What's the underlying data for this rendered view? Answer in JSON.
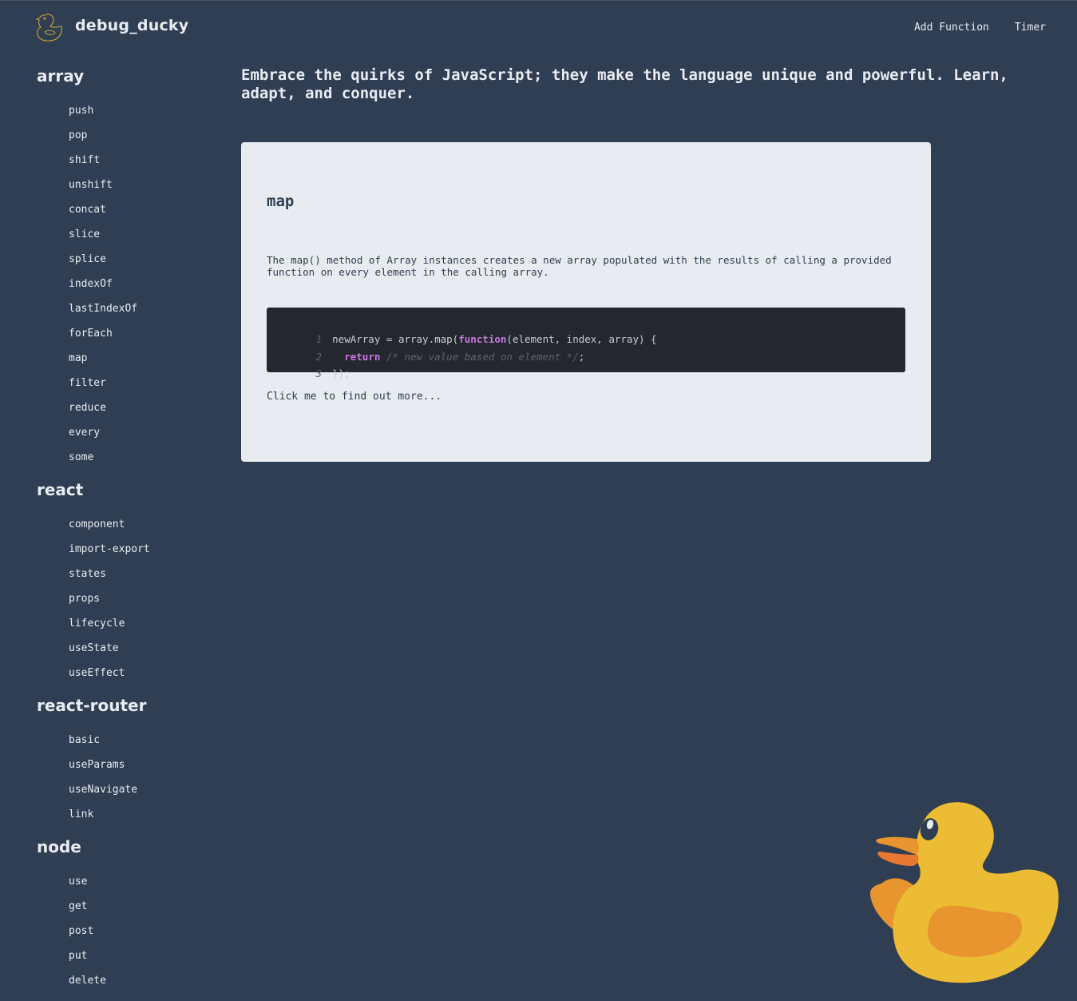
{
  "header": {
    "brand": "debug_ducky",
    "logo_icon": "duck-outline-icon",
    "nav": [
      {
        "label": "Add Function"
      },
      {
        "label": "Timer"
      }
    ]
  },
  "tagline": "Embrace the quirks of JavaScript; they make the language unique and powerful. Learn, adapt, and conquer.",
  "sidebar": {
    "groups": [
      {
        "title": "array",
        "items": [
          "push",
          "pop",
          "shift",
          "unshift",
          "concat",
          "slice",
          "splice",
          "indexOf",
          "lastIndexOf",
          "forEach",
          "map",
          "filter",
          "reduce",
          "every",
          "some"
        ]
      },
      {
        "title": "react",
        "items": [
          "component",
          "import-export",
          "states",
          "props",
          "lifecycle",
          "useState",
          "useEffect"
        ]
      },
      {
        "title": "react-router",
        "items": [
          "basic",
          "useParams",
          "useNavigate",
          "link"
        ]
      },
      {
        "title": "node",
        "items": [
          "use",
          "get",
          "post",
          "put",
          "delete"
        ]
      }
    ]
  },
  "card": {
    "title": "map",
    "description": "The map() method of Array instances creates a new array populated with the results of calling a provided function on every element in the calling array.",
    "code": {
      "lines": [
        {
          "num": "1",
          "pre": "newArray = array.map(",
          "kw": "function",
          "post": "(element, index, array) {",
          "comment": ""
        },
        {
          "num": "2",
          "pre": "  ",
          "kw": "return",
          "post": " ",
          "comment": "/* new value based on element */",
          "tail": ";"
        },
        {
          "num": "3",
          "pre": "});",
          "kw": "",
          "post": "",
          "comment": ""
        }
      ]
    },
    "more_link": "Click me to find out more..."
  },
  "colors": {
    "background": "#2f3e53",
    "card": "#e8ecf0",
    "code_bg": "#24272e",
    "keyword": "#c678dd",
    "duck_body": "#ebbc34",
    "duck_wing": "#e8952f",
    "duck_beak": "#e8782f"
  }
}
